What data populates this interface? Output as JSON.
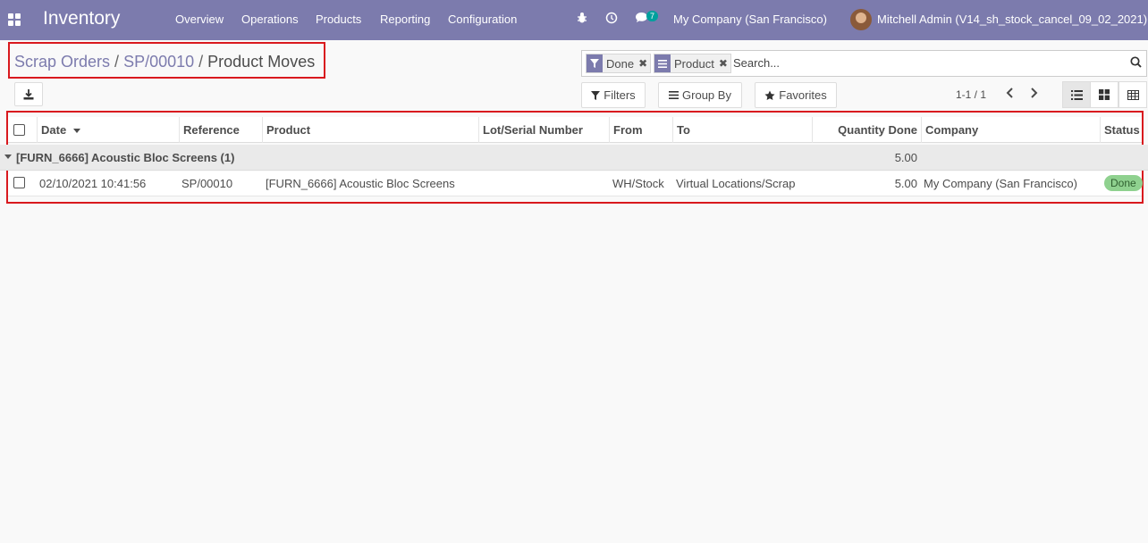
{
  "navbar": {
    "app_name": "Inventory",
    "menu": [
      "Overview",
      "Operations",
      "Products",
      "Reporting",
      "Configuration"
    ],
    "messages_count": "7",
    "company": "My Company (San Francisco)",
    "user": "Mitchell Admin (V14_sh_stock_cancel_09_02_2021)"
  },
  "breadcrumb": {
    "items": [
      "Scrap Orders",
      "SP/00010",
      "Product Moves"
    ],
    "separator": "/"
  },
  "search": {
    "facets": [
      {
        "icon": "filter-icon",
        "label": "Done"
      },
      {
        "icon": "group-by-icon",
        "label": "Product"
      }
    ],
    "placeholder": "Search..."
  },
  "toolbar": {
    "filters_label": "Filters",
    "group_by_label": "Group By",
    "favorites_label": "Favorites"
  },
  "pager": {
    "value": "1-1 / 1"
  },
  "table": {
    "columns": [
      "Date",
      "Reference",
      "Product",
      "Lot/Serial Number",
      "From",
      "To",
      "Quantity Done",
      "Company",
      "Status"
    ],
    "group": {
      "label": "[FURN_6666] Acoustic Bloc Screens (1)",
      "quantity": "5.00"
    },
    "rows": [
      {
        "date": "02/10/2021 10:41:56",
        "reference": "SP/00010",
        "product": "[FURN_6666] Acoustic Bloc Screens",
        "lot": "",
        "from": "WH/Stock",
        "to": "Virtual Locations/Scrap",
        "quantity": "5.00",
        "company": "My Company (San Francisco)",
        "status": "Done"
      }
    ]
  },
  "colors": {
    "navbar": "#7c7bad",
    "highlight_border": "#d9191e",
    "status_done": "#8fd18f"
  }
}
